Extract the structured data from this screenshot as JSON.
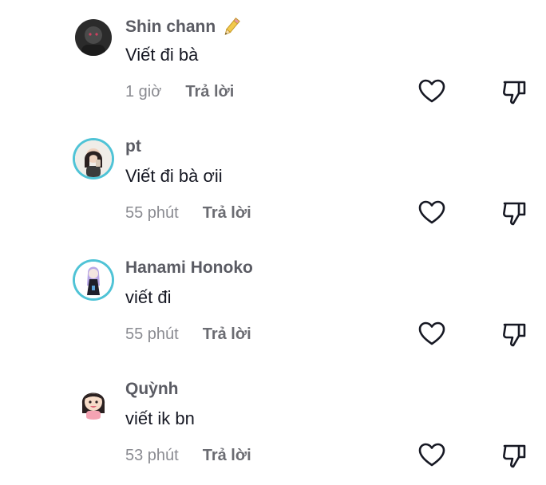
{
  "comments": [
    {
      "username": "Shin chann",
      "username_icon": "pencil-icon",
      "text": "Viết đi bà",
      "time": "1 giờ",
      "reply_label": "Trả lời",
      "avatar": "dark-portrait"
    },
    {
      "username": "pt",
      "text": "Viết đi bà ơii",
      "time": "55 phút",
      "reply_label": "Trả lời",
      "avatar": "girl-portrait-ring"
    },
    {
      "username": "Hanami Honoko",
      "text": "viết đi",
      "time": "55 phút",
      "reply_label": "Trả lời",
      "avatar": "anime-character-ring"
    },
    {
      "username": "Quỳnh",
      "text": "viết ik bn",
      "time": "53 phút",
      "reply_label": "Trả lời",
      "avatar": "cartoon-girl"
    }
  ],
  "colors": {
    "ring": "#4fc3d6",
    "username": "#5a5b63",
    "meta": "#8a8b91"
  }
}
